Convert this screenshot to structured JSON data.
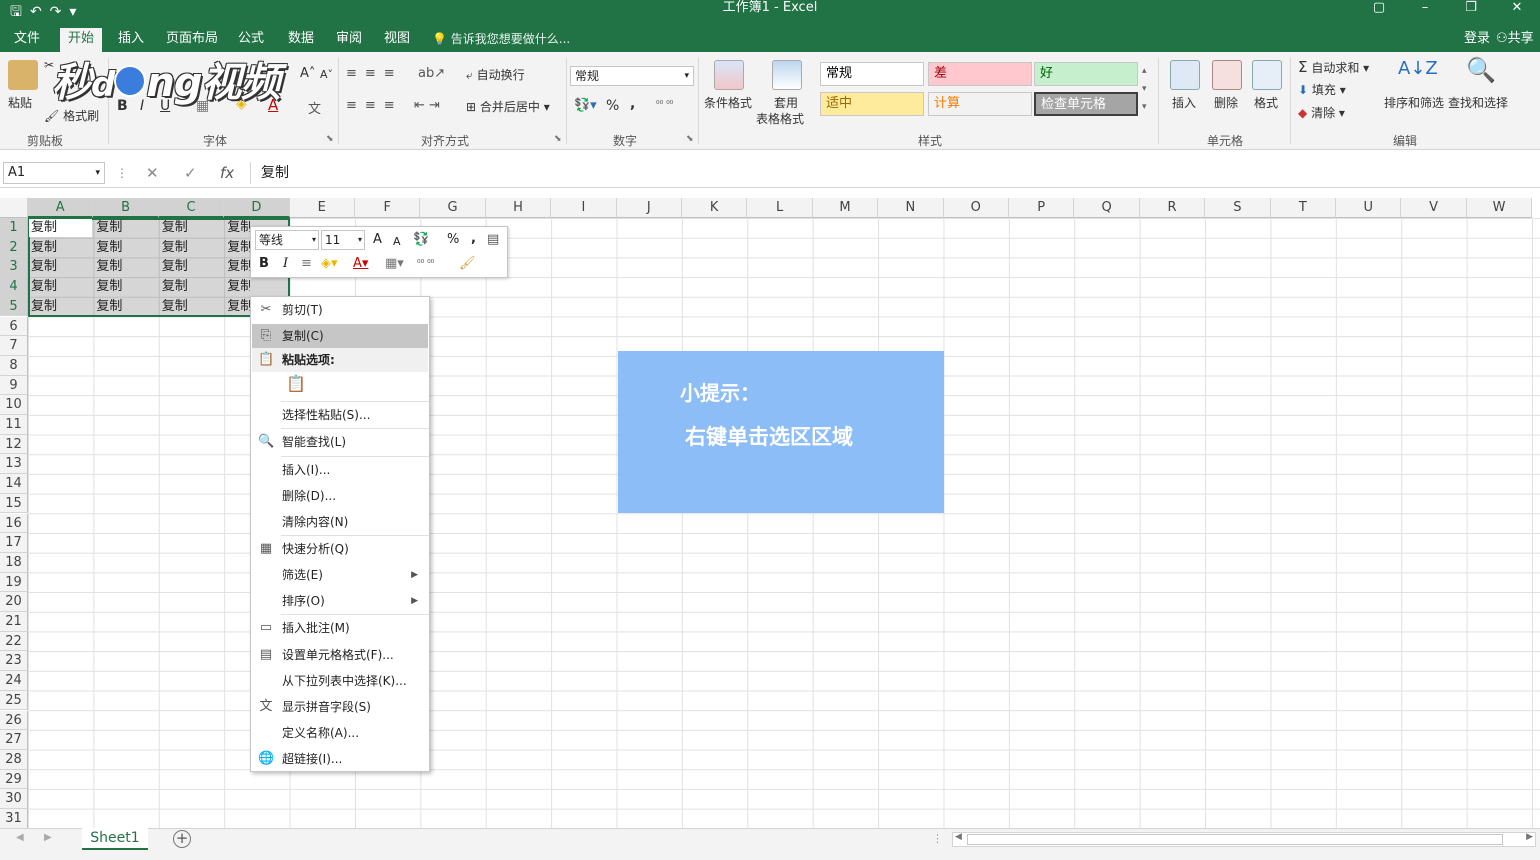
{
  "window": {
    "title": "工作簿1 - Excel",
    "controls": [
      "▢",
      "–",
      "❐",
      "✕"
    ]
  },
  "qat": {
    "save": "🖫",
    "undo": "↶",
    "redo": "↷",
    "custom": "▾"
  },
  "tabs": [
    "文件",
    "开始",
    "插入",
    "页面布局",
    "公式",
    "数据",
    "审阅",
    "视图"
  ],
  "active_tab": "开始",
  "tell_me": "告诉我您想要做什么...",
  "account": {
    "login": "登录",
    "share": "共享"
  },
  "ribbon": {
    "groups": [
      "剪贴板",
      "字体",
      "对齐方式",
      "数字",
      "样式",
      "单元格",
      "编辑"
    ],
    "clipboard": {
      "paste": "粘贴",
      "format_painter": "格式刷"
    },
    "font": {
      "bold": "B",
      "italic": "I",
      "underline": "U"
    },
    "alignment": {
      "wrap_text": "自动换行",
      "merge_center": "合并后居中"
    },
    "number": {
      "format": "常规",
      "percent": "%",
      "comma": ","
    },
    "styles": {
      "conditional": "条件格式",
      "table_format_1": "套用",
      "table_format_2": "表格格式",
      "boxes": [
        {
          "label": "常规",
          "bg": "#ffffff",
          "fg": "#000000"
        },
        {
          "label": "差",
          "bg": "#ffc7ce",
          "fg": "#9c0006"
        },
        {
          "label": "好",
          "bg": "#c6efce",
          "fg": "#006100"
        },
        {
          "label": "适中",
          "bg": "#ffeb9c",
          "fg": "#9c6500"
        },
        {
          "label": "计算",
          "bg": "#f2f2f2",
          "fg": "#fa7d00"
        },
        {
          "label": "检查单元格",
          "bg": "#a5a5a5",
          "fg": "#ffffff"
        }
      ]
    },
    "cells": {
      "insert": "插入",
      "delete": "删除",
      "format": "格式"
    },
    "editing": {
      "autosum": "自动求和",
      "fill": "填充",
      "clear": "清除",
      "sort_filter": "排序和筛选",
      "find_select": "查找和选择"
    }
  },
  "formula_bar": {
    "name_box": "A1",
    "fx": "fx",
    "cancel": "✕",
    "enter": "✓",
    "content": "复制"
  },
  "columns": [
    "A",
    "B",
    "C",
    "D",
    "E",
    "F",
    "G",
    "H",
    "I",
    "J",
    "K",
    "L",
    "M",
    "N",
    "O",
    "P",
    "Q",
    "R",
    "S",
    "T",
    "U",
    "V",
    "W"
  ],
  "rows": [
    "1",
    "2",
    "3",
    "4",
    "5",
    "6",
    "7",
    "8",
    "9",
    "10",
    "11",
    "12",
    "13",
    "14",
    "15",
    "16",
    "17",
    "18",
    "19",
    "20",
    "21",
    "22",
    "23",
    "24",
    "25",
    "26",
    "27",
    "28",
    "29",
    "30",
    "31"
  ],
  "cells": [
    [
      "复制",
      "复制",
      "复制",
      "复制"
    ],
    [
      "复制",
      "复制",
      "复制",
      "复制"
    ],
    [
      "复制",
      "复制",
      "复制",
      "复制"
    ],
    [
      "复制",
      "复制",
      "复制",
      "复制"
    ],
    [
      "复制",
      "复制",
      "复制",
      "复制"
    ]
  ],
  "mini_toolbar": {
    "font": "等线",
    "size": "11",
    "grow": "A",
    "shrink": "A",
    "percent": "%",
    "comma": ",",
    "bold": "B",
    "italic": "I"
  },
  "context_menu": {
    "items": [
      {
        "label": "剪切(T)",
        "icon": "scissors-icon",
        "glyph": "✂"
      },
      {
        "label": "复制(C)",
        "icon": "copy-icon",
        "glyph": "⎘",
        "highlighted": true
      },
      {
        "label": "粘贴选项:",
        "icon": "paste-icon",
        "glyph": "📋",
        "section": true
      },
      {
        "label": "",
        "icon": "paste-option-icon",
        "glyph": "📋"
      },
      {
        "label": "选择性粘贴(S)...",
        "icon": "",
        "glyph": ""
      },
      {
        "label": "智能查找(L)",
        "icon": "smart-lookup-icon",
        "glyph": "🔍"
      },
      {
        "label": "插入(I)...",
        "icon": "",
        "glyph": ""
      },
      {
        "label": "删除(D)...",
        "icon": "",
        "glyph": ""
      },
      {
        "label": "清除内容(N)",
        "icon": "",
        "glyph": ""
      },
      {
        "label": "快速分析(Q)",
        "icon": "quick-analysis-icon",
        "glyph": "▦"
      },
      {
        "label": "筛选(E)",
        "icon": "",
        "glyph": "",
        "submenu": true
      },
      {
        "label": "排序(O)",
        "icon": "",
        "glyph": "",
        "submenu": true
      },
      {
        "label": "插入批注(M)",
        "icon": "comment-icon",
        "glyph": "▭"
      },
      {
        "label": "设置单元格格式(F)...",
        "icon": "format-cells-icon",
        "glyph": "▤"
      },
      {
        "label": "从下拉列表中选择(K)...",
        "icon": "",
        "glyph": ""
      },
      {
        "label": "显示拼音字段(S)",
        "icon": "phonetic-icon",
        "glyph": "文"
      },
      {
        "label": "定义名称(A)...",
        "icon": "",
        "glyph": ""
      },
      {
        "label": "超链接(I)...",
        "icon": "hyperlink-icon",
        "glyph": "🌐"
      }
    ]
  },
  "hint": {
    "title": "小提示：",
    "body": "右键单击选区区域"
  },
  "sheet_tabs": [
    "Sheet1"
  ],
  "add_sheet": "+",
  "watermark": {
    "text1": "秒",
    "text2": "ng视频"
  },
  "colors": {
    "excel_green": "#217346",
    "hint_bg": "#8dbdf7"
  }
}
